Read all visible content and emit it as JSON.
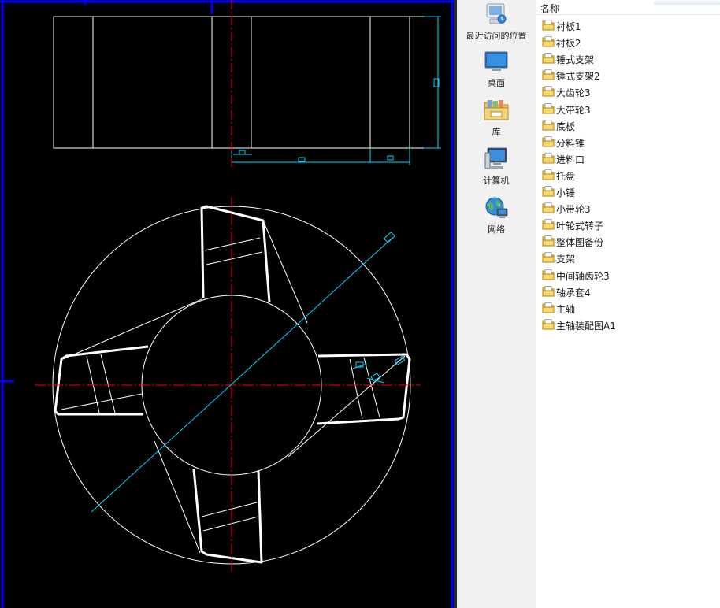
{
  "cad_view": {
    "background": "#000000",
    "colors": {
      "geometry": "#ffffff",
      "centerline": "#ff0000",
      "dimension": "#00d7ff",
      "frame": "#0000ff"
    }
  },
  "nav_pane": {
    "items": [
      {
        "label": "最近访问的位置",
        "icon": "recent-places-icon"
      },
      {
        "label": "桌面",
        "icon": "desktop-icon"
      },
      {
        "label": "库",
        "icon": "libraries-icon"
      },
      {
        "label": "计算机",
        "icon": "computer-icon"
      },
      {
        "label": "网络",
        "icon": "network-icon"
      }
    ]
  },
  "file_list": {
    "column_header": "名称",
    "items": [
      "衬板1",
      "衬板2",
      "锤式支架",
      "锤式支架2",
      "大齿轮3",
      "大带轮3",
      "底板",
      "分料锥",
      "进料口",
      "托盘",
      "小锤",
      "小带轮3",
      "叶轮式转子",
      "整体图备份",
      "支架",
      "中间轴齿轮3",
      "轴承套4",
      "主轴",
      "主轴装配图A1"
    ]
  }
}
